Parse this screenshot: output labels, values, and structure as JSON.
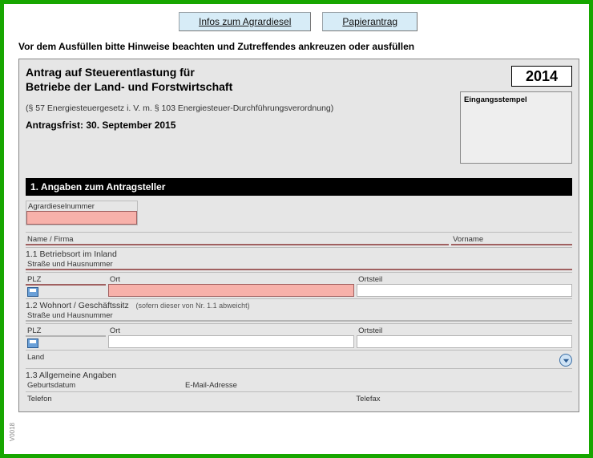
{
  "topButtons": {
    "agrar": "Infos zum Agrardiesel",
    "paper": "Papierantrag"
  },
  "instruction": "Vor dem Ausfüllen bitte Hinweise beachten und Zutreffendes ankreuzen oder ausfüllen",
  "title1": "Antrag auf Steuerentlastung für",
  "title2": "Betriebe der Land- und Forstwirtschaft",
  "law": "(§ 57 Energiesteuergesetz i. V. m. § 103 Energiesteuer-Durchführungsverordnung)",
  "frist": "Antragsfrist: 30. September 2015",
  "year": "2014",
  "stamp": "Eingangsstempel",
  "s1": {
    "title": "1. Angaben zum Antragsteller"
  },
  "labels": {
    "agrnr": "Agrardieselnummer",
    "namefirma": "Name / Firma",
    "vorname": "Vorname",
    "sub11": "1.1 Betriebsort im Inland",
    "strasse": "Straße und Hausnummer",
    "plz": "PLZ",
    "ort": "Ort",
    "ortsteil": "Ortsteil",
    "sub12": "1.2 Wohnort / Geschäftssitz",
    "sub12note": "(sofern dieser von Nr. 1.1 abweicht)",
    "land": "Land",
    "sub13": "1.3 Allgemeine Angaben",
    "geb": "Geburtsdatum",
    "email": "E-Mail-Adresse",
    "telefon": "Telefon",
    "telefax": "Telefax"
  },
  "sideCode": "V0018"
}
